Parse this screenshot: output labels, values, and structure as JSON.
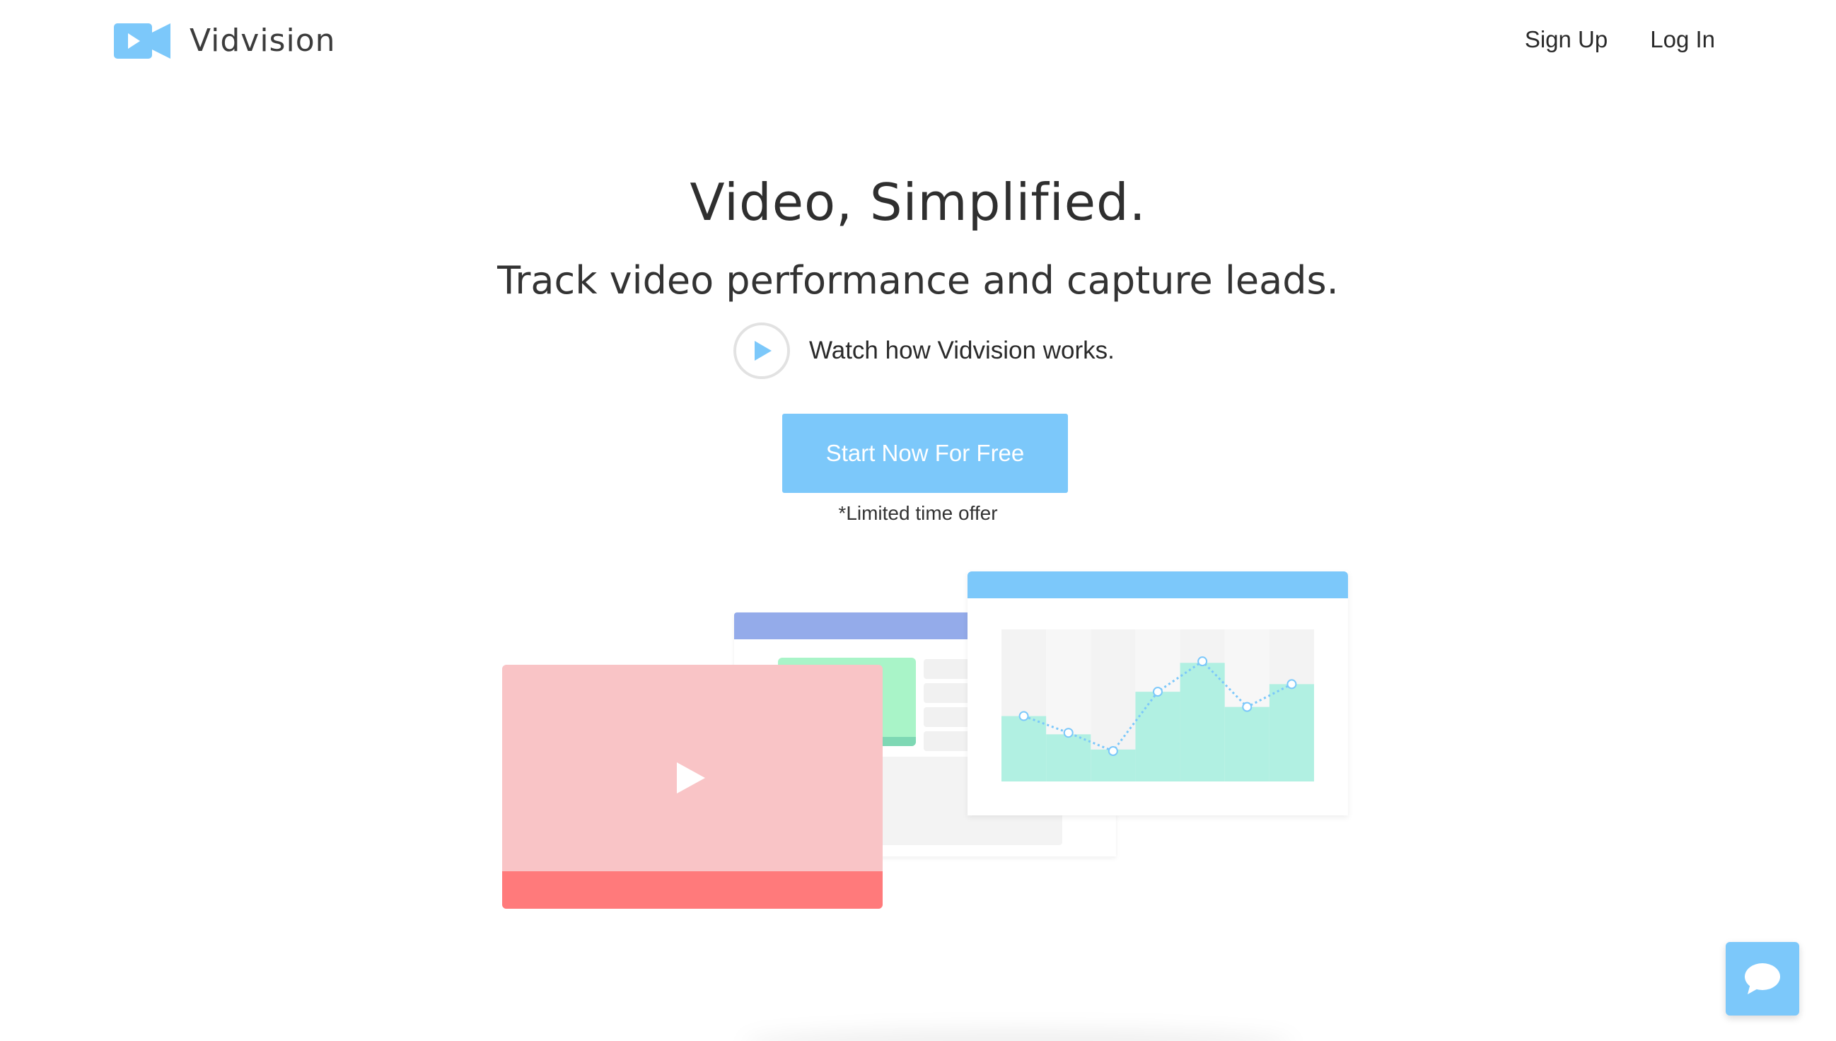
{
  "brand": {
    "name": "Vidvision",
    "accent_color": "#7cc8fa",
    "logo_icon": "video-camera-icon"
  },
  "nav": {
    "signup_label": "Sign Up",
    "login_label": "Log In"
  },
  "hero": {
    "title": "Video, Simplified.",
    "subtitle": "Track video performance and capture leads.",
    "watch_label": "Watch how Vidvision works.",
    "watch_icon": "play-circle-icon",
    "cta_label": "Start Now For Free",
    "offer_note": "*Limited time offer"
  },
  "illustration": {
    "colors": {
      "video_card": "#f9c4c6",
      "video_bar": "#ff7a7b",
      "list_header": "#94abea",
      "thumbnail": "#a9f4c8",
      "chart_header": "#7cc8fa",
      "chart_bars": "#b1f0e2"
    },
    "chart_bars": [
      0.43,
      0.31,
      0.21,
      0.59,
      0.78,
      0.49,
      0.64
    ],
    "chart_line": [
      0.43,
      0.32,
      0.2,
      0.59,
      0.79,
      0.49,
      0.64
    ]
  },
  "chat": {
    "icon": "chat-bubble-icon"
  }
}
